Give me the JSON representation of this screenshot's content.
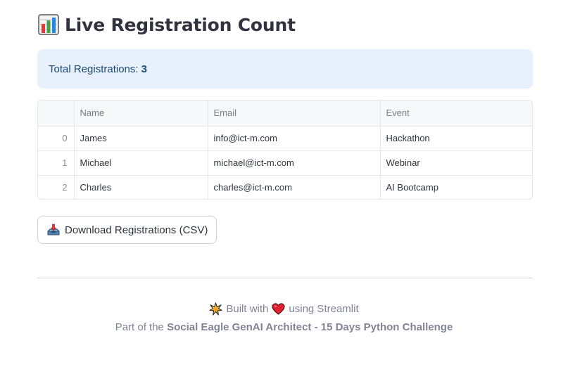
{
  "header": {
    "title": "Live Registration Count",
    "title_icon": "bar-chart-icon"
  },
  "summary": {
    "label": "Total Registrations:",
    "count": "3"
  },
  "table": {
    "columns": [
      "",
      "Name",
      "Email",
      "Event"
    ],
    "rows": [
      {
        "index": "0",
        "name": "James",
        "email": "info@ict-m.com",
        "event": "Hackathon"
      },
      {
        "index": "1",
        "name": "Michael",
        "email": "michael@ict-m.com",
        "event": "Webinar"
      },
      {
        "index": "2",
        "name": "Charles",
        "email": "charles@ict-m.com",
        "event": "AI Bootcamp"
      }
    ]
  },
  "download_button": {
    "label": "Download Registrations (CSV)",
    "icon": "inbox-tray-icon"
  },
  "footer": {
    "built_with": "Built with",
    "using": "using Streamlit",
    "part_of": "Part of the",
    "challenge_name": "Social Eagle GenAI Architect - 15 Days Python Challenge",
    "sparkle_icon": "sparkle-icon",
    "heart_icon": "heart-icon"
  },
  "colors": {
    "info_bg": "#e8f1fb",
    "info_text": "#1a4a75",
    "heart": "#e0202e",
    "text": "#31333f",
    "muted": "#808495"
  }
}
